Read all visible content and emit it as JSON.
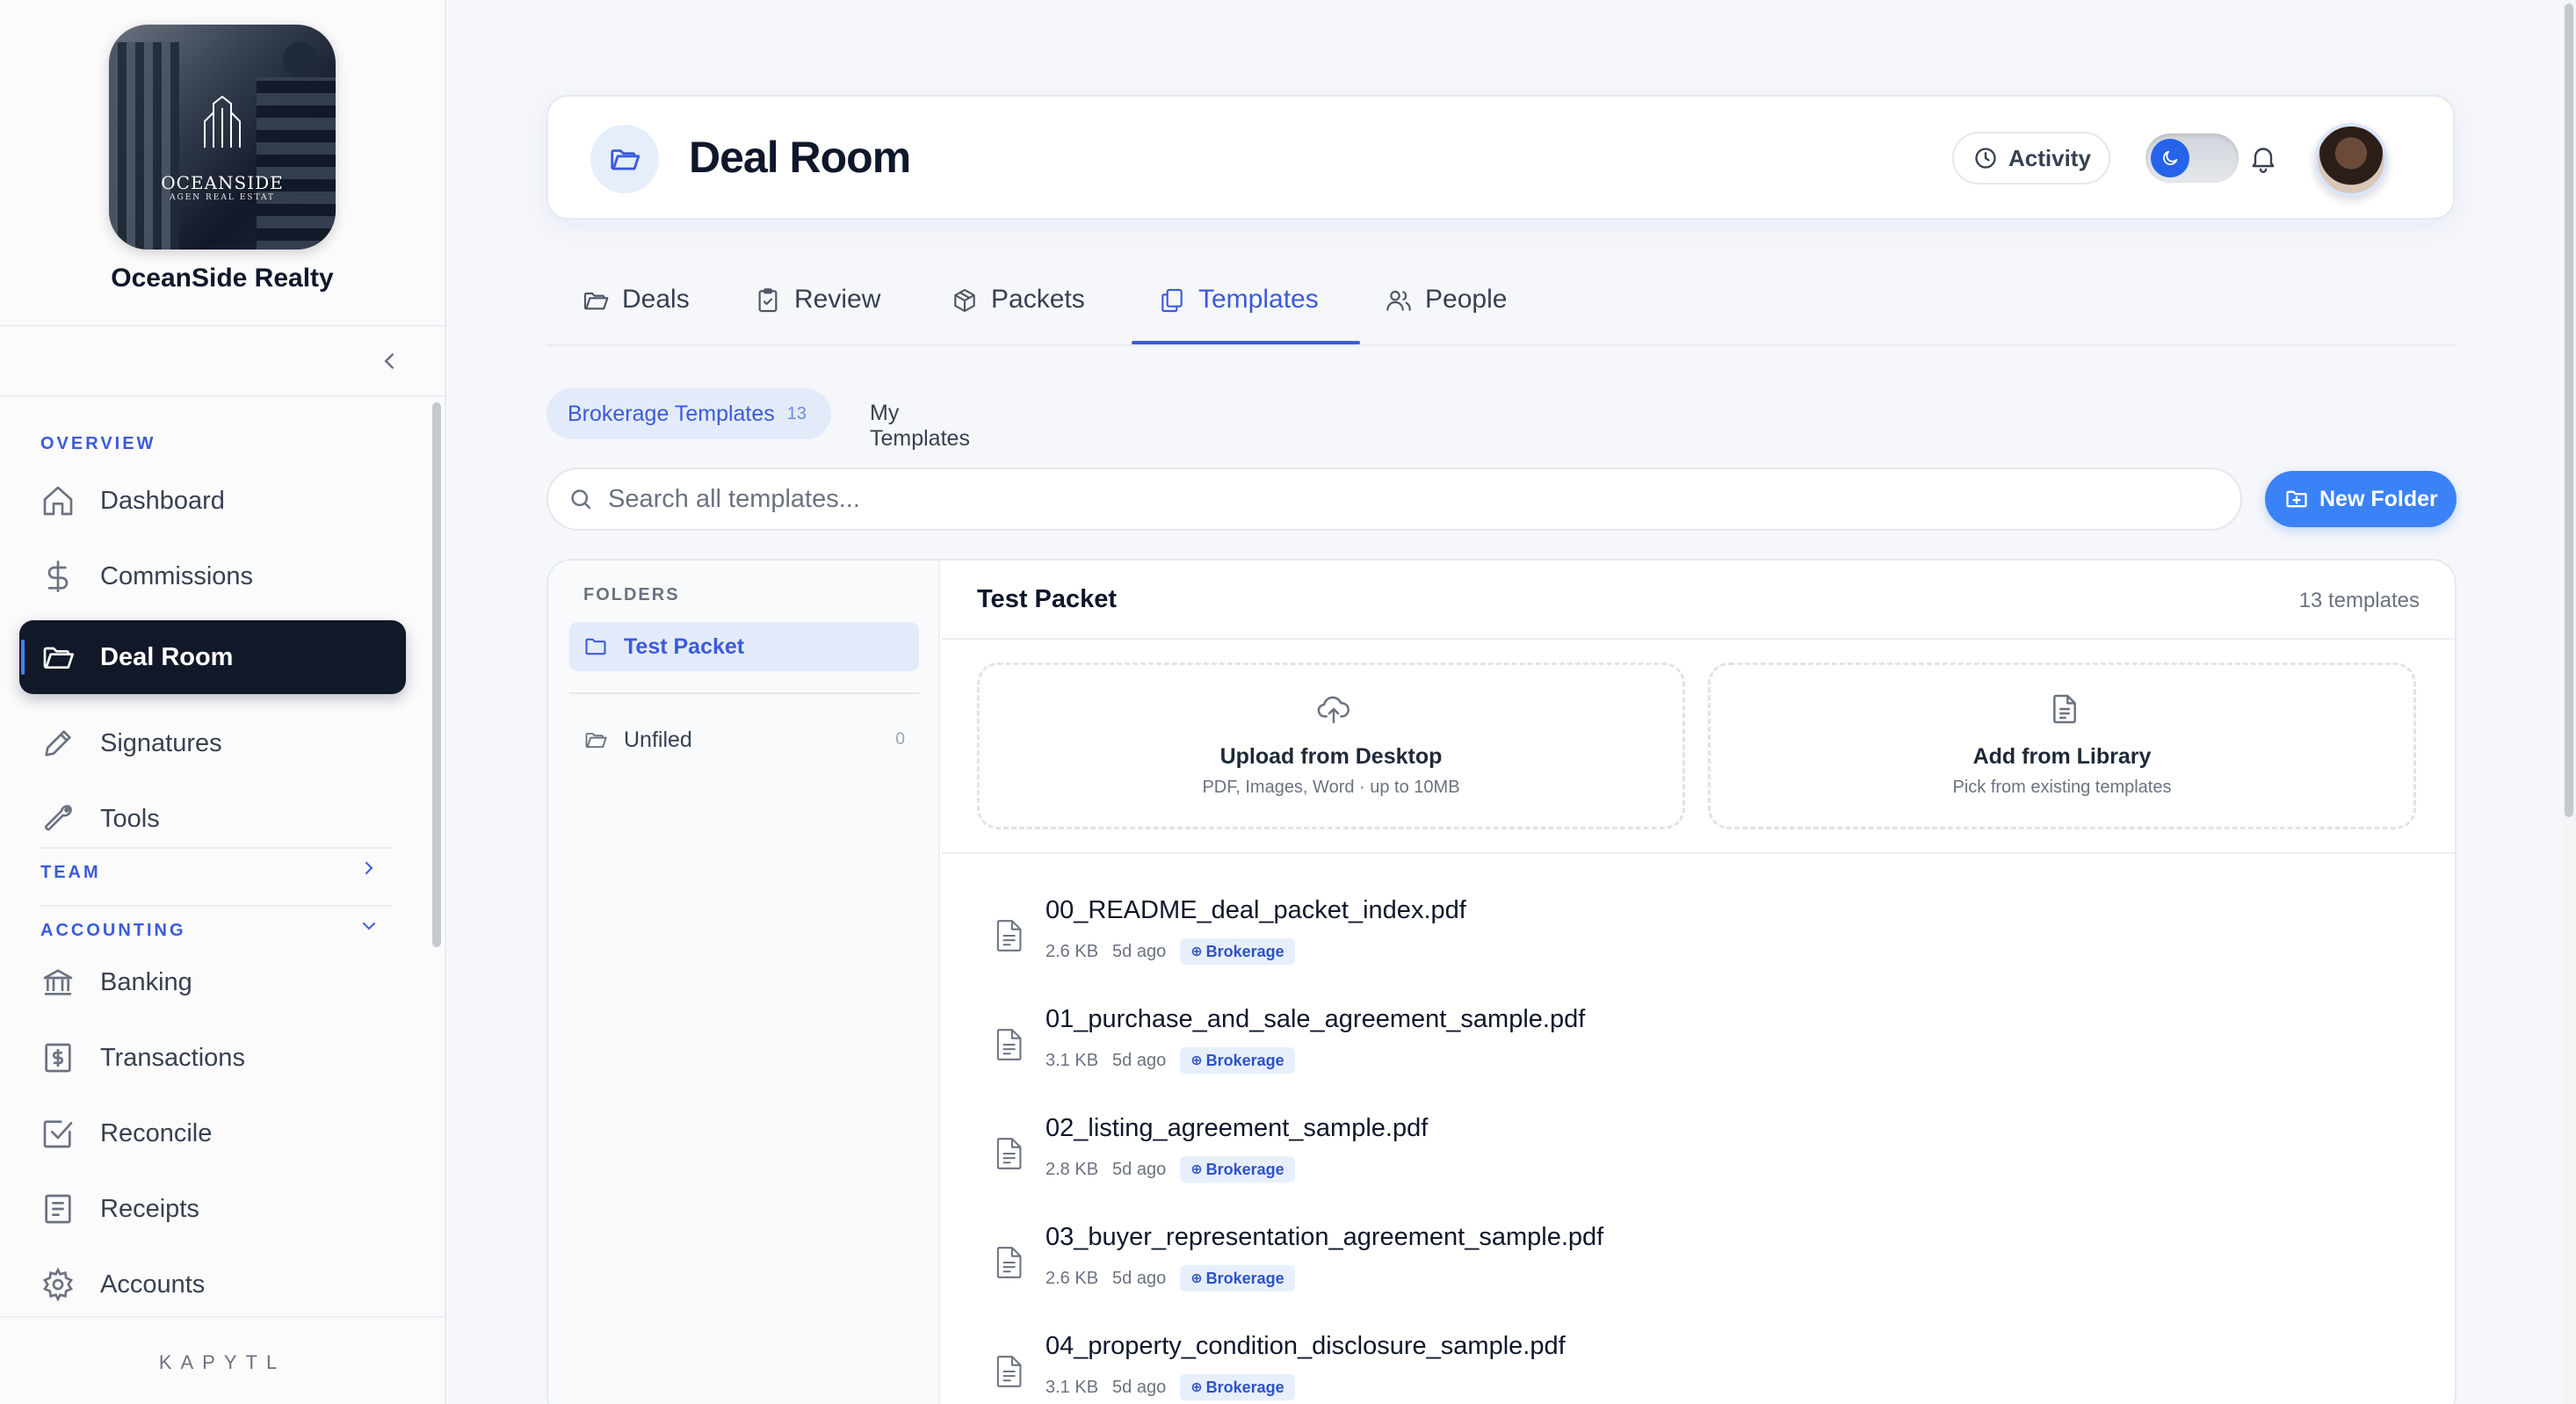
{
  "sidebar": {
    "brand": {
      "logo_name": "OCEANSIDE",
      "logo_sub": "AGEN REAL ESTAT",
      "name": "OceanSide Realty"
    },
    "sections": {
      "overview": "OVERVIEW",
      "team": "TEAM",
      "accounting": "ACCOUNTING"
    },
    "items": [
      {
        "label": "Dashboard",
        "icon": "home-icon"
      },
      {
        "label": "Commissions",
        "icon": "dollar-icon"
      },
      {
        "label": "Deal Room",
        "icon": "folder-open-icon",
        "active": true
      },
      {
        "label": "Signatures",
        "icon": "pen-icon"
      },
      {
        "label": "Tools",
        "icon": "wrench-icon"
      },
      {
        "label": "Banking",
        "icon": "bank-icon"
      },
      {
        "label": "Transactions",
        "icon": "receipt-dollar-icon"
      },
      {
        "label": "Reconcile",
        "icon": "check-square-icon"
      },
      {
        "label": "Receipts",
        "icon": "receipt-icon"
      },
      {
        "label": "Accounts",
        "icon": "gear-icon"
      }
    ],
    "footer": "KAPYTL"
  },
  "header": {
    "title": "Deal Room",
    "activity_label": "Activity"
  },
  "tabs": [
    {
      "label": "Deals",
      "icon": "folder-icon"
    },
    {
      "label": "Review",
      "icon": "clipboard-check-icon"
    },
    {
      "label": "Packets",
      "icon": "package-icon"
    },
    {
      "label": "Templates",
      "icon": "copy-icon",
      "active": true
    },
    {
      "label": "People",
      "icon": "users-icon"
    }
  ],
  "subtabs": {
    "brokerage": {
      "label": "Brokerage Templates",
      "count": "13"
    },
    "mine": {
      "label": "My Templates"
    }
  },
  "search": {
    "placeholder": "Search all templates..."
  },
  "new_folder_label": "New Folder",
  "folders": {
    "heading": "FOLDERS",
    "items": [
      {
        "name": "Test Packet",
        "selected": true
      },
      {
        "name": "Unfiled",
        "count": "0"
      }
    ]
  },
  "content": {
    "title": "Test Packet",
    "count": "13 templates",
    "upload": {
      "title": "Upload from Desktop",
      "sub": "PDF, Images, Word · up to 10MB"
    },
    "library": {
      "title": "Add from Library",
      "sub": "Pick from existing templates"
    },
    "files": [
      {
        "name": "00_README_deal_packet_index.pdf",
        "size": "2.6 KB",
        "ago": "5d ago",
        "badge": "Brokerage"
      },
      {
        "name": "01_purchase_and_sale_agreement_sample.pdf",
        "size": "3.1 KB",
        "ago": "5d ago",
        "badge": "Brokerage"
      },
      {
        "name": "02_listing_agreement_sample.pdf",
        "size": "2.8 KB",
        "ago": "5d ago",
        "badge": "Brokerage"
      },
      {
        "name": "03_buyer_representation_agreement_sample.pdf",
        "size": "2.6 KB",
        "ago": "5d ago",
        "badge": "Brokerage"
      },
      {
        "name": "04_property_condition_disclosure_sample.pdf",
        "size": "3.1 KB",
        "ago": "5d ago",
        "badge": "Brokerage"
      }
    ]
  },
  "colors": {
    "accent": "#3b5bdb",
    "primary_button": "#3b82f6",
    "active_nav": "#111827"
  }
}
